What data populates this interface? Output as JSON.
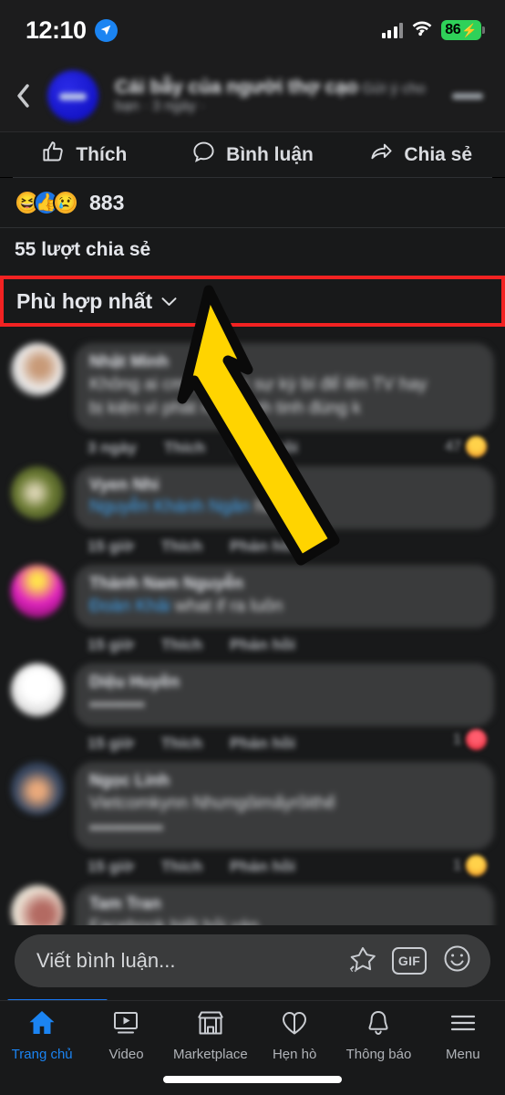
{
  "status_bar": {
    "time": "12:10",
    "location_icon": "location-arrow-icon",
    "signal_icon": "cellular-signal-icon",
    "wifi_icon": "wifi-icon",
    "battery_level": "86",
    "battery_charging_icon": "lightning-bolt-icon"
  },
  "post_header": {
    "back_icon": "back-chevron-icon",
    "avatar": "page-avatar",
    "title": "Cái bẫy của người thợ cạo",
    "subtitle": "Gửi ý cho bạn · 3 ngày ·",
    "menu_icon": "more-options-icon"
  },
  "actions": [
    {
      "label": "Thích",
      "icon": "thumbs-up-icon"
    },
    {
      "label": "Bình luận",
      "icon": "comment-bubble-icon"
    },
    {
      "label": "Chia sẻ",
      "icon": "share-arrow-icon"
    }
  ],
  "reactions": {
    "emojis": [
      "haha-reaction",
      "like-reaction",
      "sad-reaction"
    ],
    "count": "883"
  },
  "shares": {
    "text": "55 lượt chia sẻ"
  },
  "sort": {
    "label": "Phù hợp nhất",
    "caret_icon": "chevron-down-icon",
    "highlight_color": "#f22222"
  },
  "annotation": {
    "arrow_icon": "up-left-arrow-icon",
    "arrow_fill": "#FFD400",
    "arrow_stroke": "#0a0a0a"
  },
  "comments": [
    {
      "avatar_class": "av1",
      "name": "Nhật Minh",
      "text_line1": "Không ai cmt về việc sự kỳ bí để lên TV hay",
      "text_line2": "bị kiện vì phát ngôn linh tinh đúng k",
      "time": "3 ngày",
      "like_label": "Thích",
      "reply_label": "Phản hồi",
      "reaction_count": "47",
      "reaction_emoji": "emo-haha"
    },
    {
      "avatar_class": "av2",
      "name": "Vyen Nhi",
      "mention": "Nguyễn Khánh Ngân",
      "text_after": "ha",
      "time": "15 giờ",
      "like_label": "Thích",
      "reply_label": "Phản hồi",
      "reaction_count": "",
      "reaction_emoji": ""
    },
    {
      "avatar_class": "av3",
      "name": "Thành Nam Nguyễn",
      "mention": "Đoàn Khải",
      "text_after": "what if ra luôn",
      "time": "15 giờ",
      "like_label": "Thích",
      "reply_label": "Phản hồi",
      "reaction_count": "",
      "reaction_emoji": ""
    },
    {
      "avatar_class": "av4",
      "name": "Diệu Huyền",
      "text_line1": "▪▪▪▪▪▪▪▪▪",
      "time": "15 giờ",
      "like_label": "Thích",
      "reply_label": "Phản hồi",
      "reaction_count": "1",
      "reaction_emoji": "emo-love"
    },
    {
      "avatar_class": "av5",
      "name": "Ngọc Linh",
      "mention": "Vietcomkynn Nhưngôimấyrồithế",
      "text_line2": "▪▪▪▪▪▪▪▪▪▪▪▪",
      "time": "15 giờ",
      "like_label": "Thích",
      "reply_label": "Phản hồi",
      "reaction_count": "1",
      "reaction_emoji": "emo-haha"
    },
    {
      "avatar_class": "av6",
      "name": "Tam Tran",
      "text_line1": "Facebook biết hỏi ván",
      "time": "",
      "like_label": "",
      "reply_label": "",
      "reaction_count": "",
      "reaction_emoji": ""
    }
  ],
  "composer": {
    "placeholder": "Viết bình luận...",
    "sticker_icon": "sticker-star-icon",
    "gif_label": "GIF",
    "emoji_icon": "smiley-face-icon"
  },
  "tabbar": [
    {
      "label": "Trang chủ",
      "icon": "home-icon",
      "active": true
    },
    {
      "label": "Video",
      "icon": "video-icon",
      "active": false
    },
    {
      "label": "Marketplace",
      "icon": "marketplace-store-icon",
      "active": false
    },
    {
      "label": "Hẹn hò",
      "icon": "dating-heart-icon",
      "active": false
    },
    {
      "label": "Thông báo",
      "icon": "bell-icon",
      "active": false
    },
    {
      "label": "Menu",
      "icon": "hamburger-menu-icon",
      "active": false
    }
  ]
}
